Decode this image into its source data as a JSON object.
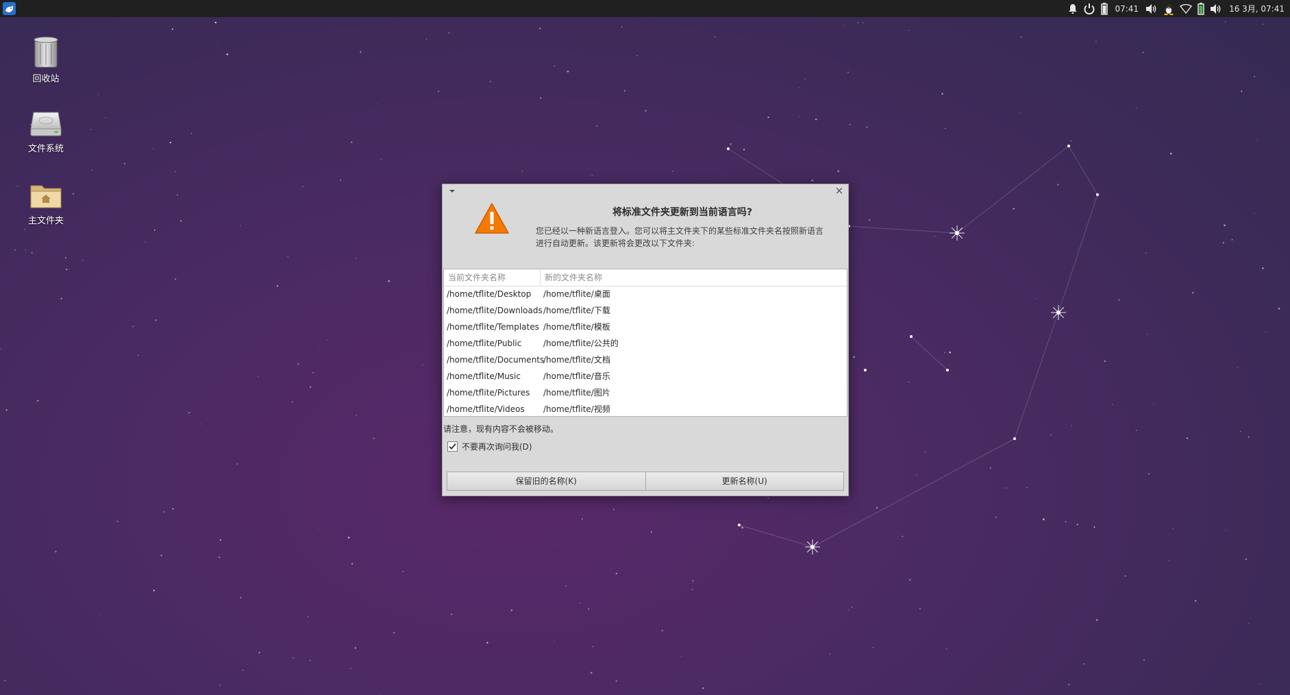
{
  "top_panel": {
    "menu_icon": "xfce-menu-icon",
    "indicators": {
      "clock_short": "07:41",
      "datetime": "16 3月, 07:41"
    }
  },
  "desktop_icons": [
    {
      "label": "回收站",
      "icon": "trash-icon"
    },
    {
      "label": "文件系统",
      "icon": "drive-icon"
    },
    {
      "label": "主文件夹",
      "icon": "home-folder-icon"
    }
  ],
  "dialog": {
    "heading": "将标准文件夹更新到当前语言吗?",
    "description": "您已经以一种新语言登入。您可以将主文件夹下的某些标准文件夹名按照新语言进行自动更新。该更新将会更改以下文件夹:",
    "table": {
      "headers": [
        "当前文件夹名称",
        "新的文件夹名称"
      ],
      "rows": [
        [
          "/home/tflite/Desktop",
          "/home/tflite/桌面"
        ],
        [
          "/home/tflite/Downloads",
          "/home/tflite/下载"
        ],
        [
          "/home/tflite/Templates",
          "/home/tflite/模板"
        ],
        [
          "/home/tflite/Public",
          "/home/tflite/公共的"
        ],
        [
          "/home/tflite/Documents",
          "/home/tflite/文档"
        ],
        [
          "/home/tflite/Music",
          "/home/tflite/音乐"
        ],
        [
          "/home/tflite/Pictures",
          "/home/tflite/图片"
        ],
        [
          "/home/tflite/Videos",
          "/home/tflite/视频"
        ]
      ]
    },
    "note": "请注意，现有内容不会被移动。",
    "checkbox": {
      "label": "不要再次询问我(D)",
      "checked": true
    },
    "buttons": {
      "keep": "保留旧的名称(K)",
      "update": "更新名称(U)"
    },
    "close_symbol": "×"
  },
  "colors": {
    "panel_bg": "#202020",
    "desktop_bg": "#4a2a62",
    "warning_orange": "#f57900"
  }
}
